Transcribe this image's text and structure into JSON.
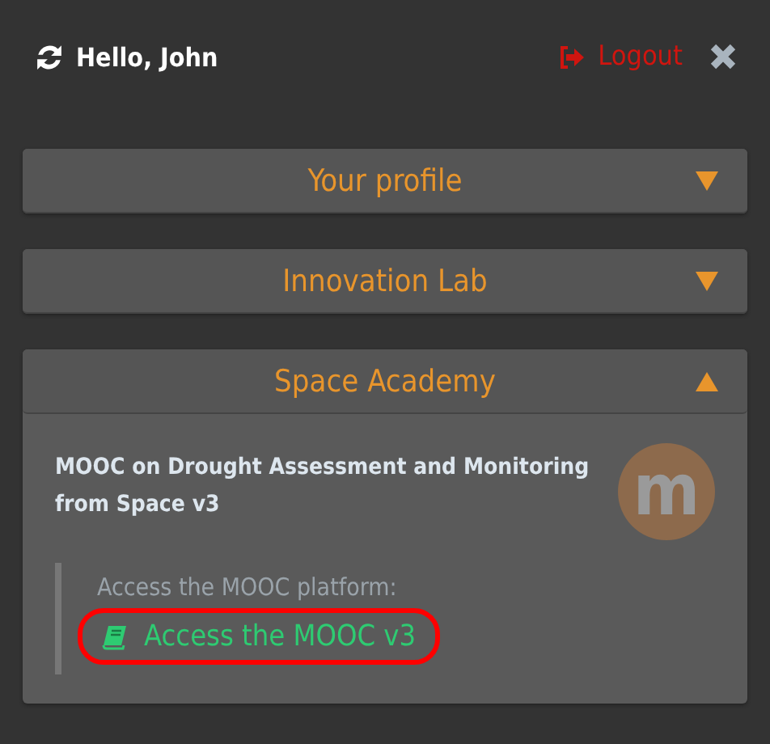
{
  "header": {
    "greeting": "Hello, John",
    "logout": "Logout"
  },
  "sections": [
    {
      "title": "Your profile",
      "expanded": false
    },
    {
      "title": "Innovation Lab",
      "expanded": false
    },
    {
      "title": "Space Academy",
      "expanded": true,
      "course": {
        "title": "MOOC on Drought Assessment and Monitoring from Space v3",
        "logo": "m",
        "prompt": "Access the MOOC platform:",
        "link": "Access the MOOC v3",
        "highlighted": true
      }
    }
  ]
}
